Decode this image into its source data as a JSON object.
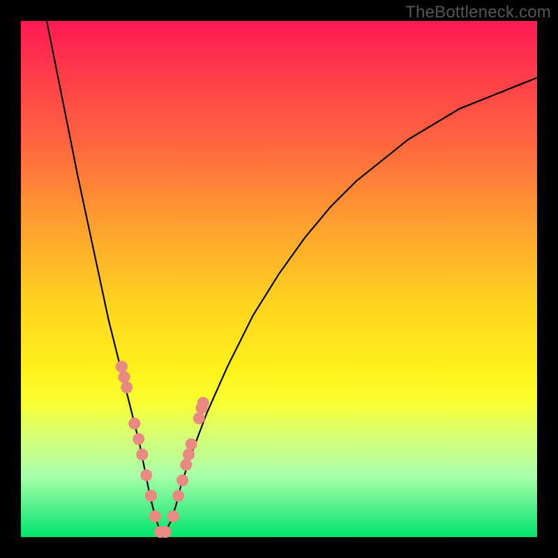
{
  "watermark": "TheBottleneck.com",
  "colors": {
    "frame": "#000000",
    "curve": "#000000",
    "marker_fill": "#e98a82",
    "marker_stroke": "#e98a82"
  },
  "chart_data": {
    "type": "line",
    "title": "",
    "xlabel": "",
    "ylabel": "",
    "xlim": [
      0,
      100
    ],
    "ylim": [
      0,
      100
    ],
    "grid": false,
    "legend": "none",
    "background": "vertical-gradient red→yellow→green (bottleneck heat map)",
    "annotations": [
      "TheBottleneck.com"
    ],
    "series": [
      {
        "name": "bottleneck-curve",
        "description": "V-shaped bottleneck percentage curve; minimum near x≈27 at y≈0",
        "x": [
          5,
          8,
          11,
          14,
          17,
          20,
          23,
          24,
          25,
          26,
          27,
          28,
          29,
          30,
          31,
          33,
          36,
          40,
          45,
          50,
          55,
          60,
          65,
          70,
          75,
          80,
          85,
          90,
          95,
          100
        ],
        "values": [
          100,
          85,
          70,
          56,
          42,
          30,
          18,
          13,
          8,
          4,
          1,
          1,
          3,
          6,
          10,
          16,
          24,
          33,
          43,
          51,
          58,
          64,
          69,
          73,
          77,
          80,
          83,
          85,
          87,
          89
        ]
      },
      {
        "name": "highlighted-points",
        "description": "Salmon dot markers overlaid on the curve near the trough",
        "x": [
          19.5,
          20,
          20.5,
          22,
          22.8,
          23.5,
          24.3,
          25.2,
          26,
          27,
          28,
          29.5,
          30.5,
          31.3,
          32,
          32.5,
          33,
          34.5,
          35,
          35.3
        ],
        "values": [
          33,
          31,
          29,
          22,
          19,
          16,
          12,
          8,
          4,
          1,
          1,
          4,
          8,
          11,
          14,
          16,
          18,
          23,
          25,
          26
        ]
      }
    ]
  }
}
